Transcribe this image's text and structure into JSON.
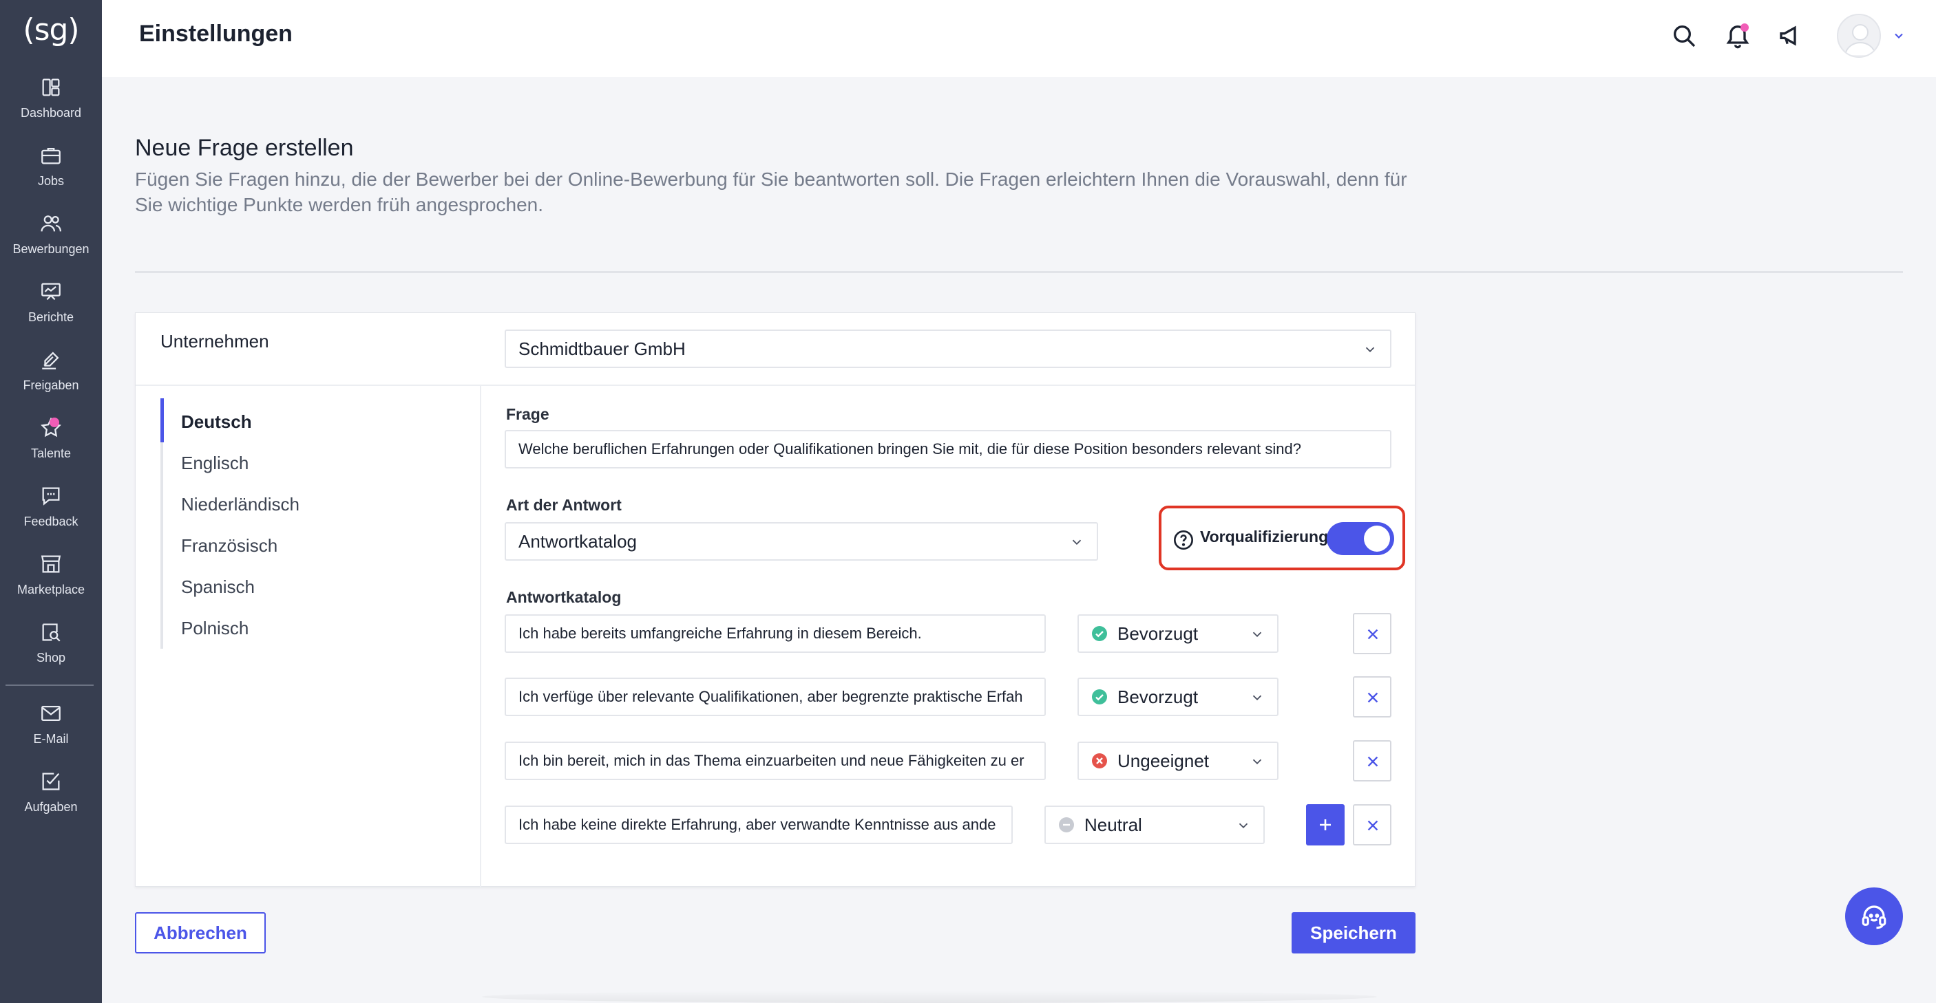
{
  "app": {
    "logo": "(sg)"
  },
  "sidebar": {
    "items": [
      {
        "label": "Dashboard",
        "icon": "dashboard-icon"
      },
      {
        "label": "Jobs",
        "icon": "briefcase-icon"
      },
      {
        "label": "Bewerbungen",
        "icon": "users-icon"
      },
      {
        "label": "Berichte",
        "icon": "chart-board-icon"
      },
      {
        "label": "Freigaben",
        "icon": "sign-icon"
      },
      {
        "label": "Talente",
        "icon": "star-icon"
      },
      {
        "label": "Feedback",
        "icon": "chat-icon"
      },
      {
        "label": "Marketplace",
        "icon": "store-icon"
      },
      {
        "label": "Shop",
        "icon": "shop-search-icon"
      },
      {
        "label": "E-Mail",
        "icon": "mail-icon"
      },
      {
        "label": "Aufgaben",
        "icon": "checklist-icon"
      }
    ]
  },
  "header": {
    "title": "Einstellungen"
  },
  "page": {
    "title": "Neue Frage erstellen",
    "description": "Fügen Sie Fragen hinzu, die der Bewerber bei der Online-Bewerbung für Sie beantworten soll. Die Fragen erleichtern Ihnen die Vorauswahl, denn für Sie wichtige Punkte werden früh angesprochen."
  },
  "form": {
    "company_label": "Unternehmen",
    "company_value": "Schmidtbauer GmbH",
    "languages": [
      "Deutsch",
      "Englisch",
      "Niederländisch",
      "Französisch",
      "Spanisch",
      "Polnisch"
    ],
    "active_language": "Deutsch",
    "question_label": "Frage",
    "question_value": "Welche beruflichen Erfahrungen oder Qualifikationen bringen Sie mit, die für diese Position besonders relevant sind?",
    "answer_type_label": "Art der Antwort",
    "answer_type_value": "Antwortkatalog",
    "prequal_label": "Vorqualifizierung",
    "prequal_enabled": true,
    "catalog_label": "Antwortkatalog",
    "answers": [
      {
        "text": "Ich habe bereits umfangreiche Erfahrung in diesem Bereich.",
        "status": "Bevorzugt"
      },
      {
        "text": "Ich verfüge über relevante Qualifikationen, aber begrenzte praktische Erfah",
        "status": "Bevorzugt"
      },
      {
        "text": "Ich bin bereit, mich in das Thema einzuarbeiten und neue Fähigkeiten zu er",
        "status": "Ungeeignet"
      },
      {
        "text": "Ich habe keine direkte Erfahrung, aber verwandte Kenntnisse aus ande",
        "status": "Neutral"
      }
    ]
  },
  "actions": {
    "cancel": "Abbrechen",
    "save": "Speichern"
  },
  "colors": {
    "accent": "#4b55e8",
    "sidebar": "#373e50",
    "preferred": "#3fbf9a",
    "unsuitable": "#e5534b",
    "neutral": "#c8cbd2",
    "highlight": "#e03525"
  }
}
